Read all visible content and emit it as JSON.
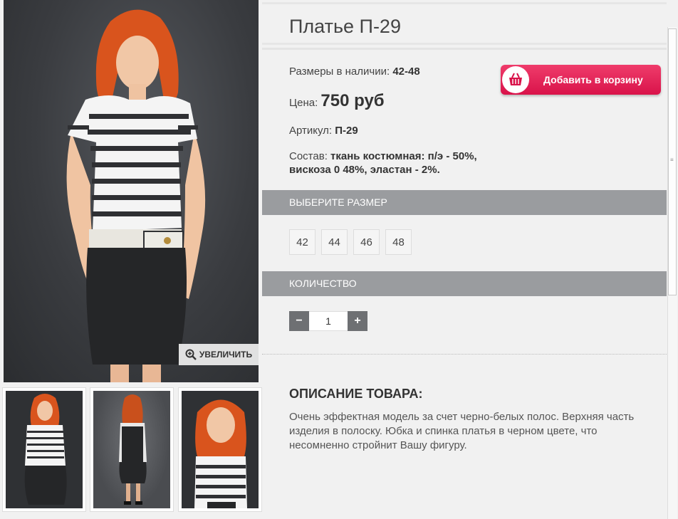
{
  "product": {
    "title": "Платье П-29",
    "sizes_label": "Размеры в наличии:",
    "sizes_value": "42-48",
    "price_label": "Цена:",
    "price_value": "750 руб",
    "article_label": "Артикул:",
    "article_value": "П-29",
    "composition_label": "Состав:",
    "composition_value": "ткань костюмная: п/э - 50%, вискоза 0 48%, эластан - 2%."
  },
  "cart_button": {
    "label": "Добавить в корзину",
    "color": "#e2245a"
  },
  "gallery": {
    "zoom_label": "УВЕЛИЧИТЬ"
  },
  "size_section": {
    "heading": "ВЫБЕРИТЕ РАЗМЕР",
    "options": [
      "42",
      "44",
      "46",
      "48"
    ]
  },
  "quantity_section": {
    "heading": "КОЛИЧЕСТВО",
    "minus": "−",
    "value": "1",
    "plus": "+"
  },
  "description": {
    "heading": "ОПИСАНИЕ ТОВАРА:",
    "text": "Очень эффектная модель за счет черно-белых полос. Верхняя часть изделия в полоску. Юбка и спинка платья в черном цвете, что несомненно стройнит Вашу фигуру."
  },
  "icons": {
    "zoom": "zoom-in-icon",
    "cart": "basket-icon"
  }
}
